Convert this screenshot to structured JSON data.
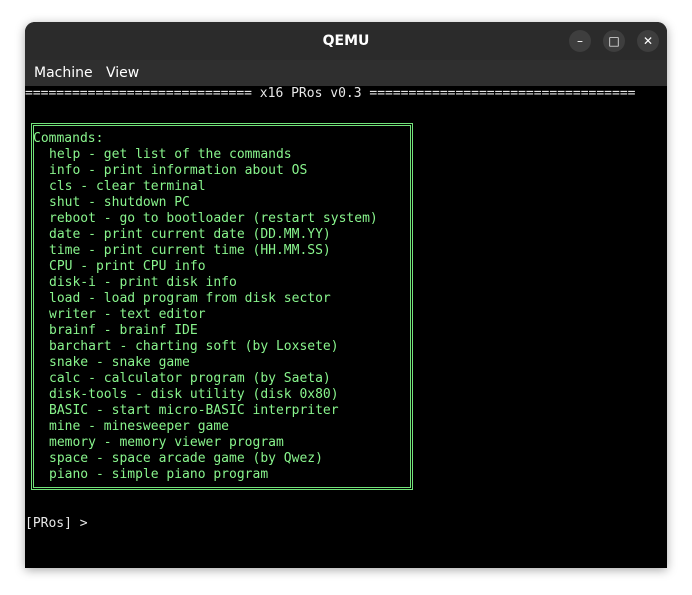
{
  "window": {
    "title": "QEMU",
    "controls": {
      "minimize": "–",
      "maximize": "□",
      "close": "✕"
    }
  },
  "menu": {
    "items": [
      "Machine",
      "View"
    ]
  },
  "terminal": {
    "banner": "============================= x16 PRos v0.3 ==================================",
    "commands_title": "Commands:",
    "commands": [
      "help - get list of the commands",
      "info - print information about OS",
      "cls - clear terminal",
      "shut - shutdown PC",
      "reboot - go to bootloader (restart system)",
      "date - print current date (DD.MM.YY)",
      "time - print current time (HH.MM.SS)",
      "CPU - print CPU info",
      "disk-i - print disk info",
      "load - load program from disk sector",
      "writer - text editor",
      "brainf - brainf IDE",
      "barchart - charting soft (by Loxsete)",
      "snake - snake game",
      "calc - calculator program (by Saeta)",
      "disk-tools - disk utility (disk 0x80)",
      "BASIC - start micro-BASIC interpriter",
      "mine - minesweeper game",
      "memory - memory viewer program",
      "space - space arcade game (by Qwez)",
      "piano - simple piano program"
    ],
    "prompt": "[PRos] > "
  },
  "colors": {
    "terminal_bg": "#000000",
    "terminal_text": "#e8e8e8",
    "command_green": "#89f58d",
    "titlebar": "#2b2b2b"
  }
}
